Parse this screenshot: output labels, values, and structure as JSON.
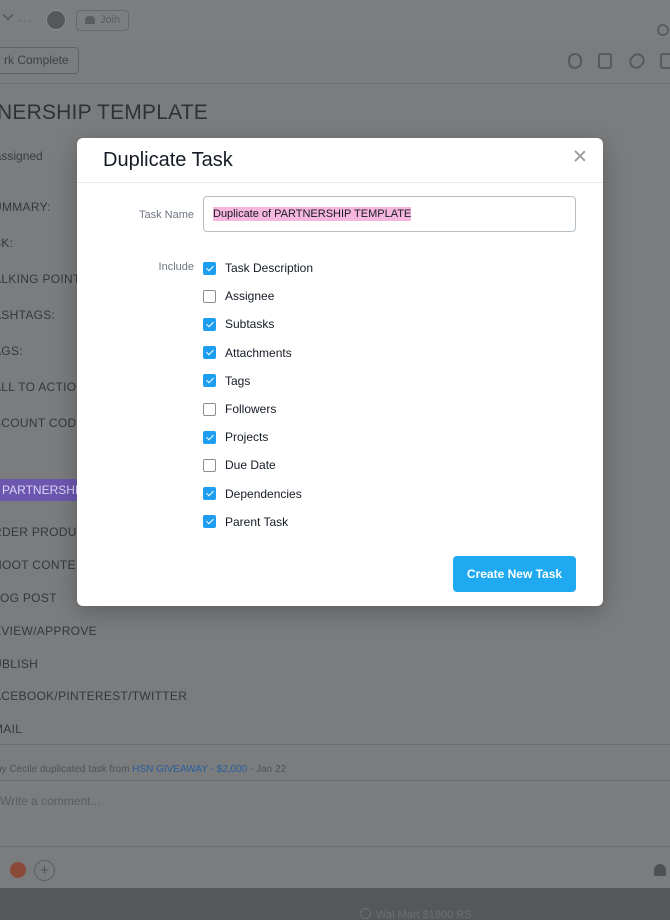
{
  "topbar": {
    "join_label": "Join"
  },
  "task": {
    "mark_complete_label": "rk Complete",
    "title": "TNERSHIP TEMPLATE",
    "assignee_text": "nassigned",
    "fields": [
      "UMMARY:",
      "SK:",
      "ALKING POINT",
      "ASHTAGS:",
      "AGS:",
      "ALL TO ACTIO",
      "SCOUNT COD"
    ],
    "project_tag": "PARTNERSHI",
    "subtasks": [
      "RDER PRODU",
      "HOOT CONTE",
      "LOG POST",
      "EVIEW/APPROVE",
      "UBLISH",
      "ACEBOOK/PINTEREST/TWITTER",
      "MAIL"
    ],
    "story": {
      "text": "ny Cecile duplicated task from ",
      "link": "HSN GIVEAWAY - $2,000",
      "date": " - Jan 22"
    },
    "comment_placeholder": "Write a comment..."
  },
  "bottom_strip": {
    "item": "Wal Mart $1800 RS"
  },
  "modal": {
    "title": "Duplicate Task",
    "task_name_label": "Task Name",
    "task_name_value": "Duplicate of PARTNERSHIP TEMPLATE",
    "include_label": "Include",
    "options": [
      {
        "label": "Task Description",
        "checked": true
      },
      {
        "label": "Assignee",
        "checked": false
      },
      {
        "label": "Subtasks",
        "checked": true
      },
      {
        "label": "Attachments",
        "checked": true
      },
      {
        "label": "Tags",
        "checked": true
      },
      {
        "label": "Followers",
        "checked": false
      },
      {
        "label": "Projects",
        "checked": true
      },
      {
        "label": "Due Date",
        "checked": false
      },
      {
        "label": "Dependencies",
        "checked": true
      },
      {
        "label": "Parent Task",
        "checked": true
      }
    ],
    "create_button_label": "Create New Task"
  },
  "colors": {
    "checkbox_checked": "#1d9ef0",
    "primary_button": "#1ea9f0",
    "name_highlight": "#f7b6dc",
    "tag_highlight": "#6c57b0"
  }
}
